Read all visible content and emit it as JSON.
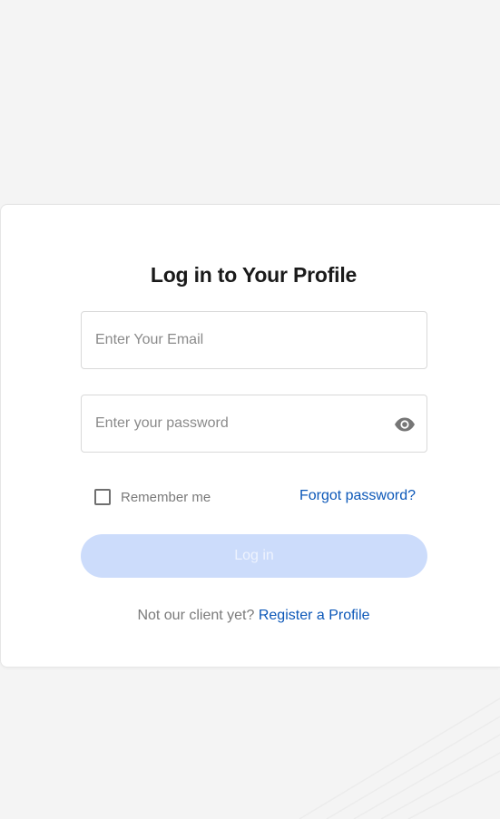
{
  "page": {
    "background_color": "#f4f4f4"
  },
  "login_form": {
    "title": "Log in to Your Profile",
    "email": {
      "value": "",
      "placeholder": "Enter Your Email"
    },
    "password": {
      "value": "",
      "placeholder": "Enter your password",
      "toggle_icon": "eye-icon"
    },
    "remember_me": {
      "label": "Remember me",
      "checked": false
    },
    "forgot_password_label": "Forgot password?",
    "login_button_label": "Log in",
    "login_button_disabled": true,
    "register_prompt": "Not our client yet?",
    "register_link_label": "Register a Profile"
  },
  "colors": {
    "link": "#0b57b8",
    "button_disabled_bg": "#ccdcfb",
    "title_text": "#1a1a1a",
    "muted_text": "#7a7a7a"
  }
}
